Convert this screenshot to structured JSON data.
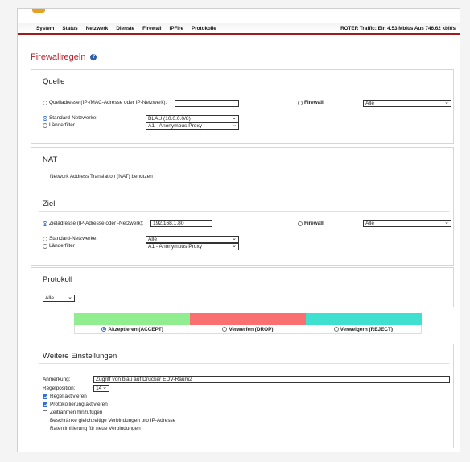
{
  "nav": {
    "menu": [
      "System",
      "Status",
      "Netzwerk",
      "Dienste",
      "Firewall",
      "IPFire",
      "Protokolle"
    ],
    "traffic": "ROTER Traffic: Ein 4.53 Mbit/s  Aus 746.62 kbit/s"
  },
  "page_title": "Firewallregeln",
  "help_icon": "?",
  "quelle": {
    "title": "Quelle",
    "source_address_label": "Quelladresse (IP-/MAC-Adresse oder IP-Netzwerk):",
    "source_address_value": "",
    "firewall_label": "Firewall",
    "firewall_select": "Alle",
    "standard_networks_label": "Standard-Netzwerke:",
    "standard_networks_select": "BLAU (10.0.0.0/8)",
    "country_filter_label": "Länderfilter",
    "country_filter_select": "A1 - Anonymous Proxy"
  },
  "nat": {
    "title": "NAT",
    "checkbox_label": "Network Address Translation (NAT) benutzen"
  },
  "ziel": {
    "title": "Ziel",
    "target_address_label": "Zieladresse (IP-Adresse oder -Netzwerk):",
    "target_address_value": "192.168.1.80",
    "firewall_label": "Firewall",
    "firewall_select": "Alle",
    "standard_networks_label": "Standard-Netzwerke:",
    "standard_networks_select": "Alle",
    "country_filter_label": "Länderfilter",
    "country_filter_select": "A1 - Anonymous Proxy"
  },
  "protokoll": {
    "title": "Protokoll",
    "select": "Alle"
  },
  "actions": {
    "accept": "Akzeptieren (ACCEPT)",
    "drop": "Verwerfen (DROP)",
    "reject": "Verweigern (REJECT)",
    "colors": {
      "accept": "#90ee90",
      "drop": "#fa6f6f",
      "reject": "#40e0d0"
    }
  },
  "weitere": {
    "title": "Weitere Einstellungen",
    "remark_label": "Anmerkung:",
    "remark_value": "Zugriff von blau auf Drucker EDV-Raum2",
    "position_label": "Regelposition:",
    "position_value": "14",
    "options": [
      {
        "label": "Regel aktivieren",
        "checked": true
      },
      {
        "label": "Protokollierung aktivieren",
        "checked": true
      },
      {
        "label": "Zeitrahmen hinzufügen",
        "checked": false
      },
      {
        "label": "Beschränke gleichzeitige Verbindungen pro IP-Adresse",
        "checked": false
      },
      {
        "label": "Ratenlimitierung für neue Verbindungen",
        "checked": false
      }
    ]
  },
  "colors": {
    "accent_red": "#a01c1c",
    "title_red": "#b1242c",
    "radio_blue": "#2f6fd6"
  }
}
